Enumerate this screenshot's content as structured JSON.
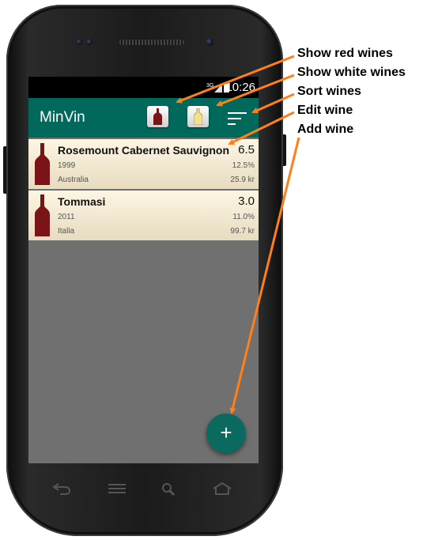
{
  "status_bar": {
    "network": "3G",
    "time": "10:26"
  },
  "app_bar": {
    "title": "MinVin"
  },
  "wines": [
    {
      "name": "Rosemount Cabernet Sauvignon",
      "rating": "6.5",
      "year": "1999",
      "abv": "12.5%",
      "country": "Australia",
      "price": "25.9 kr",
      "type": "red"
    },
    {
      "name": "Tommasi",
      "rating": "3.0",
      "year": "2011",
      "abv": "11.0%",
      "country": "Italia",
      "price": "99.7 kr",
      "type": "red"
    }
  ],
  "fab": {
    "label": "+"
  },
  "annotations": {
    "show_red": "Show red wines",
    "show_white": "Show white wines",
    "sort": "Sort wines",
    "edit": "Edit wine",
    "add": "Add wine"
  },
  "colors": {
    "app_bar": "#00695c",
    "fab": "#0b6a5f",
    "annotation_arrow": "#ff7f1a",
    "red_wine": "#7a1417",
    "white_wine": "#f3e08a"
  },
  "icons": [
    "red-wine-bottle-icon",
    "white-wine-bottle-icon",
    "sort-icon",
    "add-icon",
    "back-icon",
    "menu-icon",
    "search-icon",
    "home-icon"
  ]
}
